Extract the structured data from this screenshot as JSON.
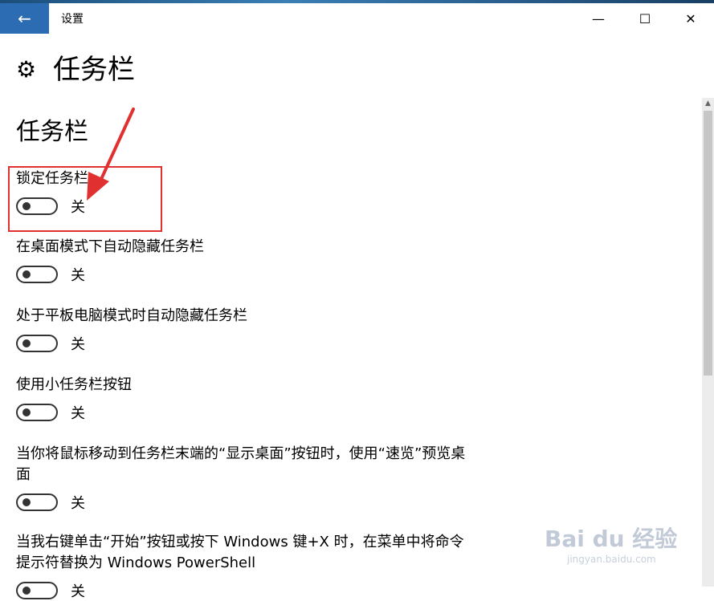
{
  "window": {
    "title": "设置",
    "back_icon": "arrow-left-icon",
    "controls": {
      "minimize": "—",
      "maximize": "☐",
      "close": "✕"
    }
  },
  "page": {
    "title": "任务栏",
    "icon": "gear-icon",
    "section_title": "任务栏"
  },
  "settings": [
    {
      "label": "锁定任务栏",
      "state": "关",
      "on": false
    },
    {
      "label": "在桌面模式下自动隐藏任务栏",
      "state": "关",
      "on": false
    },
    {
      "label": "处于平板电脑模式时自动隐藏任务栏",
      "state": "关",
      "on": false
    },
    {
      "label": "使用小任务栏按钮",
      "state": "关",
      "on": false
    },
    {
      "label": "当你将鼠标移动到任务栏末端的“显示桌面”按钮时，使用“速览”预览桌面",
      "state": "关",
      "on": false
    },
    {
      "label": "当我右键单击“开始”按钮或按下 Windows 键+X 时，在菜单中将命令提示符替换为 Windows PowerShell",
      "state": "关",
      "on": false
    }
  ],
  "annotation": {
    "highlight_color": "#e03030"
  },
  "watermark": {
    "text": "Bai du 经验",
    "sub": "jingyan.baidu.com"
  },
  "colors": {
    "accent": "#2b6cb3"
  }
}
